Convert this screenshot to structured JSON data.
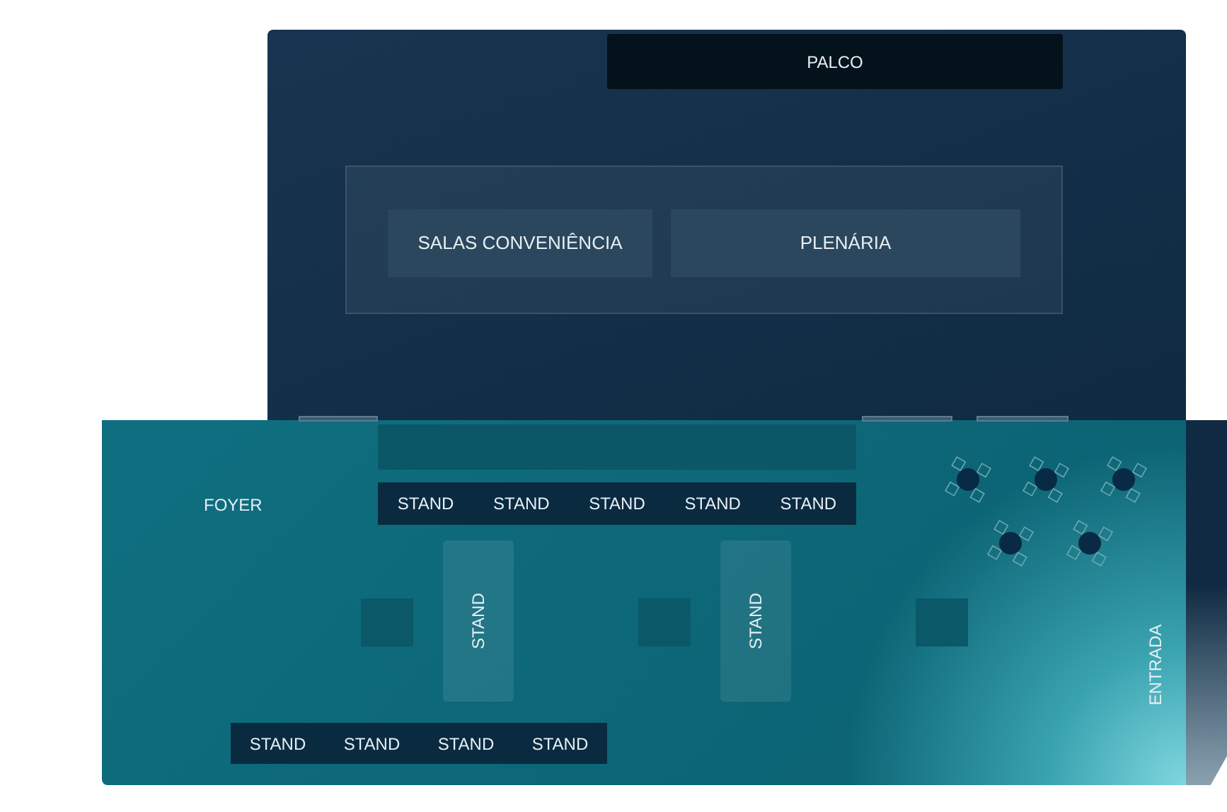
{
  "stage": {
    "label": "PALCO"
  },
  "rooms": [
    {
      "label": "SALAS CONVENIÊNCIA"
    },
    {
      "label": "PLENÁRIA"
    }
  ],
  "foyer": {
    "label": "FOYER"
  },
  "stand_row_top": [
    "STAND",
    "STAND",
    "STAND",
    "STAND",
    "STAND"
  ],
  "stands_vertical": [
    "STAND",
    "STAND"
  ],
  "stand_row_bottom": [
    "STAND",
    "STAND",
    "STAND",
    "STAND"
  ],
  "entrance": {
    "label": "ENTRADA"
  }
}
